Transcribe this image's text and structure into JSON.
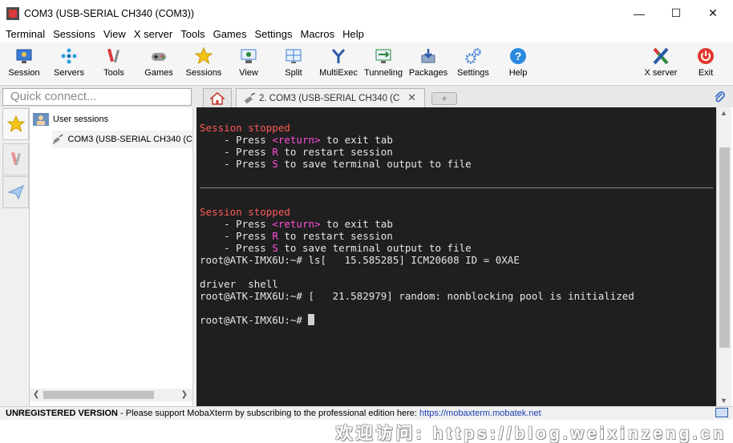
{
  "window": {
    "title": "COM3  (USB-SERIAL CH340 (COM3))",
    "controls": {
      "minimize": "—",
      "maximize": "☐",
      "close": "✕"
    }
  },
  "menu": [
    "Terminal",
    "Sessions",
    "View",
    "X server",
    "Tools",
    "Games",
    "Settings",
    "Macros",
    "Help"
  ],
  "toolbar": {
    "items": [
      {
        "label": "Session",
        "icon": "session-icon"
      },
      {
        "label": "Servers",
        "icon": "servers-icon"
      },
      {
        "label": "Tools",
        "icon": "tools-icon"
      },
      {
        "label": "Games",
        "icon": "games-icon"
      },
      {
        "label": "Sessions",
        "icon": "sessions-star-icon"
      },
      {
        "label": "View",
        "icon": "view-icon"
      },
      {
        "label": "Split",
        "icon": "split-icon"
      },
      {
        "label": "MultiExec",
        "icon": "multiexec-icon"
      },
      {
        "label": "Tunneling",
        "icon": "tunneling-icon"
      },
      {
        "label": "Packages",
        "icon": "packages-icon"
      },
      {
        "label": "Settings",
        "icon": "settings-gears-icon"
      },
      {
        "label": "Help",
        "icon": "help-icon"
      }
    ],
    "right_items": [
      {
        "label": "X server",
        "icon": "x-server-icon"
      },
      {
        "label": "Exit",
        "icon": "power-icon"
      }
    ]
  },
  "quick_connect": {
    "placeholder": "Quick connect..."
  },
  "tabs": {
    "home_icon": "home-icon",
    "active": {
      "label": "2. COM3  (USB-SERIAL CH340 (C",
      "close": "✕",
      "icon": "serial-plug-icon"
    },
    "new_tab_glyph": "+",
    "attach_icon": "paperclip-icon"
  },
  "sidebar": {
    "tabs": [
      {
        "icon": "star-icon",
        "name": "sessions-tab"
      },
      {
        "icon": "tools-tab-icon",
        "name": "tools-tab"
      },
      {
        "icon": "macros-paperplane-icon",
        "name": "macros-tab"
      }
    ],
    "tree": {
      "root": "User sessions",
      "items": [
        "COM3  (USB-SERIAL CH340 (C"
      ]
    }
  },
  "terminal": {
    "block1": {
      "header": "Session stopped",
      "lines": [
        {
          "prefix": "    - Press ",
          "key": "<return>",
          "suffix": " to exit tab"
        },
        {
          "prefix": "    - Press ",
          "key": "R",
          "suffix": " to restart session"
        },
        {
          "prefix": "    - Press ",
          "key": "S",
          "suffix": " to save terminal output to file"
        }
      ]
    },
    "block2": {
      "header": "Session stopped",
      "lines": [
        {
          "prefix": "    - Press ",
          "key": "<return>",
          "suffix": " to exit tab"
        },
        {
          "prefix": "    - Press ",
          "key": "R",
          "suffix": " to restart session"
        },
        {
          "prefix": "    - Press ",
          "key": "S",
          "suffix": " to save terminal output to file"
        }
      ]
    },
    "output": [
      "root@ATK-IMX6U:~# ls[   15.585285] ICM20608 ID = 0XAE",
      "",
      "driver  shell",
      "root@ATK-IMX6U:~# [   21.582979] random: nonblocking pool is initialized",
      "",
      "root@ATK-IMX6U:~# "
    ]
  },
  "statusbar": {
    "badge": "UNREGISTERED VERSION",
    "message": "  -  Please support MobaXterm by subscribing to the professional edition here:  ",
    "link": "https://mobaxterm.mobatek.net"
  },
  "watermark": "欢迎访问: https://blog.weixinzeng.cn",
  "colors": {
    "terminal_bg": "#1f1f1f",
    "terminal_fg": "#e6e6e6",
    "session_stopped": "#ff5a5a",
    "key_highlight": "#ff4fd8",
    "link": "#1a3fb0"
  }
}
